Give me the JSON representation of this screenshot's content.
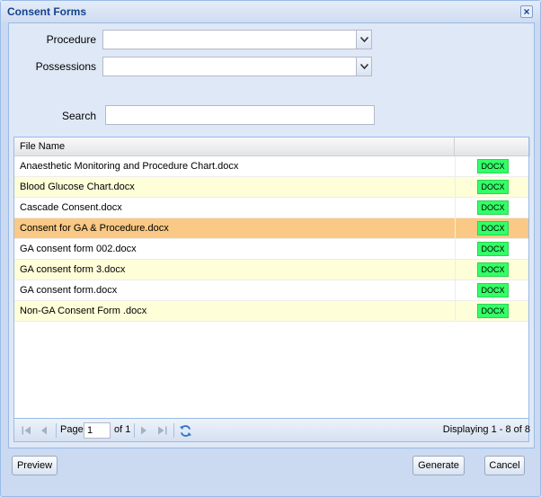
{
  "window": {
    "title": "Consent Forms"
  },
  "form": {
    "procedure_label": "Procedure",
    "procedure_value": "",
    "possessions_label": "Possessions",
    "possessions_value": "",
    "search_label": "Search",
    "search_value": ""
  },
  "grid": {
    "columns": {
      "file_name": "File Name",
      "type": ""
    },
    "rows": [
      {
        "name": "Anaesthetic Monitoring and Procedure Chart.docx",
        "type": "DOCX"
      },
      {
        "name": "Blood Glucose Chart.docx",
        "type": "DOCX"
      },
      {
        "name": "Cascade Consent.docx",
        "type": "DOCX"
      },
      {
        "name": "Consent for GA & Procedure.docx",
        "type": "DOCX"
      },
      {
        "name": "GA consent form 002.docx",
        "type": "DOCX"
      },
      {
        "name": "GA consent form 3.docx",
        "type": "DOCX"
      },
      {
        "name": "GA consent form.docx",
        "type": "DOCX"
      },
      {
        "name": "Non-GA Consent Form .docx",
        "type": "DOCX"
      }
    ],
    "selected_row": 3
  },
  "pager": {
    "page_label": "Page",
    "page_value": "1",
    "of_label": "of 1",
    "display_text": "Displaying 1 - 8 of 8"
  },
  "buttons": {
    "preview": "Preview",
    "generate": "Generate",
    "cancel": "Cancel"
  },
  "colors": {
    "title": "#15428b",
    "badge": "#33ff66",
    "selected_row": "#f9c985",
    "alt_row": "#fefed8"
  }
}
